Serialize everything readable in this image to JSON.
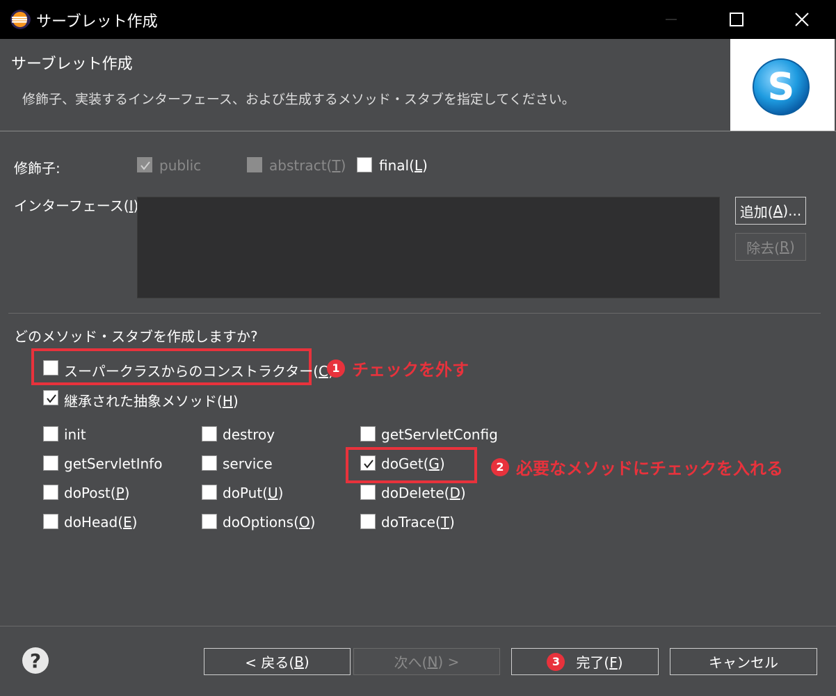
{
  "window": {
    "title": "サーブレット作成",
    "icon": "eclipse-icon"
  },
  "header": {
    "title": "サーブレット作成",
    "description": "修飾子、実装するインターフェース、および生成するメソッド・スタブを指定してください。",
    "logo_icon": "servlet-s-icon"
  },
  "modifiers": {
    "label": "修飾子:",
    "public": {
      "label": "public",
      "checked": true,
      "enabled": false
    },
    "abstract": {
      "label": "abstract(",
      "mnemonic": "T",
      "suffix": ")",
      "checked": false,
      "enabled": false
    },
    "final": {
      "label": "final(",
      "mnemonic": "L",
      "suffix": ")",
      "checked": false,
      "enabled": true
    }
  },
  "interfaces": {
    "label_prefix": "インターフェース(",
    "label_mnemonic": "I",
    "label_suffix": "):",
    "add_prefix": "追加(",
    "add_mnemonic": "A",
    "add_suffix": ")...",
    "remove_prefix": "除去(",
    "remove_mnemonic": "R",
    "remove_suffix": ")"
  },
  "stubs": {
    "question": "どのメソッド・スタブを作成しますか?",
    "superclass_ctor": {
      "label": "スーパークラスからのコンストラクター(",
      "mnemonic": "C",
      "suffix": ")",
      "checked": false
    },
    "inherited_abstract": {
      "label": "継承された抽象メソッド(",
      "mnemonic": "H",
      "suffix": ")",
      "checked": true
    },
    "methods": [
      {
        "label": "init",
        "checked": false
      },
      {
        "label": "destroy",
        "checked": false
      },
      {
        "label": "getServletConfig",
        "checked": false
      },
      {
        "label": "getServletInfo",
        "checked": false
      },
      {
        "label": "service",
        "checked": false
      },
      {
        "label": "doGet(",
        "mnemonic": "G",
        "suffix": ")",
        "checked": true
      },
      {
        "label": "doPost(",
        "mnemonic": "P",
        "suffix": ")",
        "checked": false
      },
      {
        "label": "doPut(",
        "mnemonic": "U",
        "suffix": ")",
        "checked": false
      },
      {
        "label": "doDelete(",
        "mnemonic": "D",
        "suffix": ")",
        "checked": false
      },
      {
        "label": "doHead(",
        "mnemonic": "E",
        "suffix": ")",
        "checked": false
      },
      {
        "label": "doOptions(",
        "mnemonic": "O",
        "suffix": ")",
        "checked": false
      },
      {
        "label": "doTrace(",
        "mnemonic": "T",
        "suffix": ")",
        "checked": false
      }
    ]
  },
  "annotations": [
    {
      "number": "1",
      "text": "チェックを外す"
    },
    {
      "number": "2",
      "text": "必要なメソッドにチェックを入れる"
    },
    {
      "number": "3"
    }
  ],
  "footer": {
    "help_icon": "help-icon",
    "back_prefix": "< 戻る(",
    "back_mnemonic": "B",
    "back_suffix": ")",
    "next_prefix": "次へ(",
    "next_mnemonic": "N",
    "next_suffix": ") >",
    "finish_prefix": "完了(",
    "finish_mnemonic": "F",
    "finish_suffix": ")",
    "cancel": "キャンセル"
  },
  "colors": {
    "background": "#4a4b4d",
    "titlebar": "#000000",
    "annotation": "#e8323c",
    "disabled_text": "#8a8a8a"
  }
}
